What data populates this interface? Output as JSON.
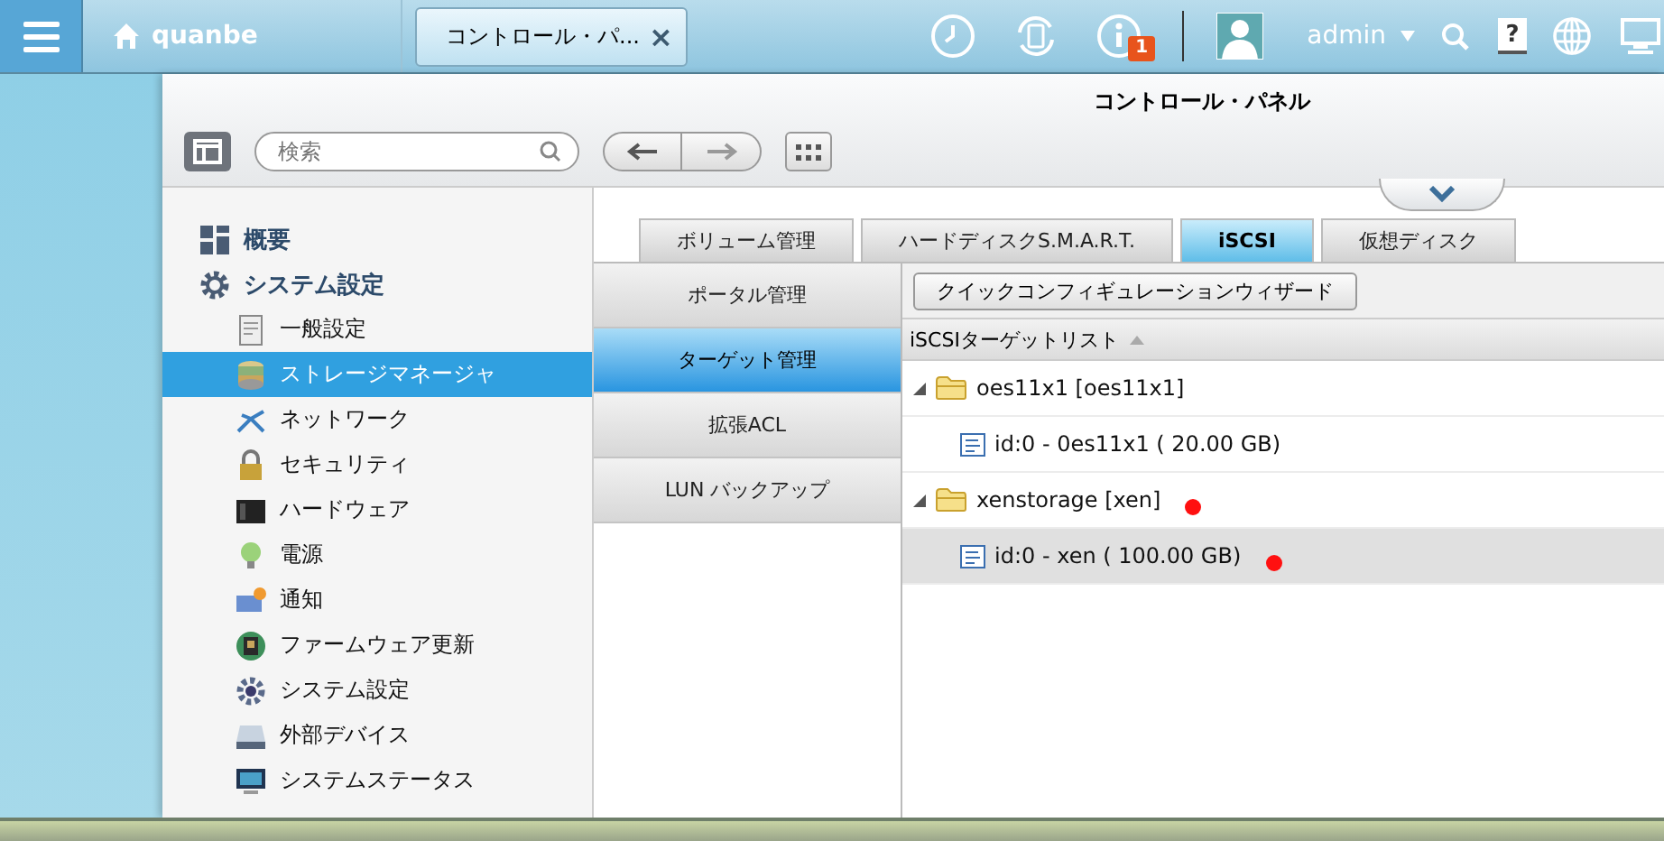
{
  "topbar": {
    "host": "quanbe",
    "task_tab": {
      "label": "コントロール・パ...",
      "close": "×"
    },
    "notifications": "1",
    "user": "admin",
    "help": "?"
  },
  "window": {
    "title": "コントロール・パネル",
    "search": {
      "placeholder": "検索"
    }
  },
  "sidebar": {
    "items": [
      {
        "label": "概要",
        "kind": "section",
        "selected": false
      },
      {
        "label": "システム設定",
        "kind": "section",
        "selected": false
      },
      {
        "label": "一般設定",
        "kind": "item",
        "selected": false
      },
      {
        "label": "ストレージマネージャ",
        "kind": "item",
        "selected": true
      },
      {
        "label": "ネットワーク",
        "kind": "item",
        "selected": false
      },
      {
        "label": "セキュリティ",
        "kind": "item",
        "selected": false
      },
      {
        "label": "ハードウェア",
        "kind": "item",
        "selected": false
      },
      {
        "label": "電源",
        "kind": "item",
        "selected": false
      },
      {
        "label": "通知",
        "kind": "item",
        "selected": false
      },
      {
        "label": "ファームウェア更新",
        "kind": "item",
        "selected": false
      },
      {
        "label": "システム設定",
        "kind": "item",
        "selected": false
      },
      {
        "label": "外部デバイス",
        "kind": "item",
        "selected": false
      },
      {
        "label": "システムステータス",
        "kind": "item",
        "selected": false
      }
    ]
  },
  "tabs": [
    {
      "label": "ボリューム管理",
      "selected": false
    },
    {
      "label": "ハードディスクS.M.A.R.T.",
      "selected": false
    },
    {
      "label": "iSCSI",
      "selected": true
    },
    {
      "label": "仮想ディスク",
      "selected": false
    }
  ],
  "subnav": [
    {
      "label": "ポータル管理",
      "selected": false
    },
    {
      "label": "ターゲット管理",
      "selected": true
    },
    {
      "label": "拡張ACL",
      "selected": false
    },
    {
      "label": "LUN バックアップ",
      "selected": false
    }
  ],
  "wizard_button": "クイックコンフィギュレーションウィザード",
  "target_list": {
    "column": "iSCSIターゲットリスト",
    "items": [
      {
        "name": "oes11x1 [oes11x1]",
        "expanded": true,
        "selected": false,
        "marked": false,
        "children": [
          {
            "name": "id:0 - 0es11x1 ( 20.00 GB)",
            "selected": false,
            "marked": false
          }
        ]
      },
      {
        "name": "xenstorage [xen]",
        "expanded": true,
        "selected": false,
        "marked": true,
        "children": [
          {
            "name": "id:0 - xen ( 100.00 GB)",
            "selected": true,
            "marked": true
          }
        ]
      }
    ]
  }
}
